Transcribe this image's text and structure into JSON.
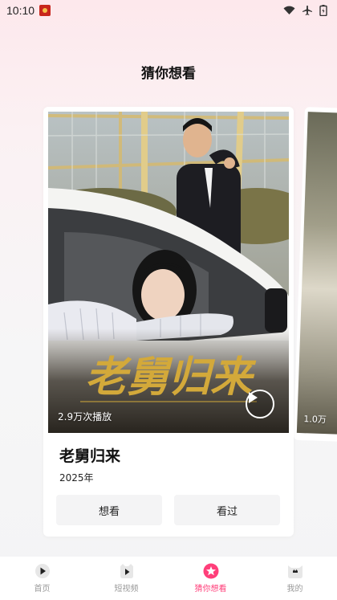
{
  "status_bar": {
    "time": "10:10",
    "icons": [
      "app-notification-icon",
      "wifi-icon",
      "airplane-mode-icon",
      "battery-icon"
    ]
  },
  "page": {
    "title": "猜你想看"
  },
  "current_card": {
    "title": "老舅归来",
    "year": "2025年",
    "play_count": "2.9万次播放",
    "want_button": "想看",
    "seen_button": "看过"
  },
  "next_card": {
    "play_count": "1.0万"
  },
  "bottom_nav": {
    "items": [
      {
        "label": "首页",
        "icon": "home-play-icon",
        "active": false
      },
      {
        "label": "短视频",
        "icon": "short-video-icon",
        "active": false
      },
      {
        "label": "猜你想看",
        "icon": "guess-flower-icon",
        "active": true
      },
      {
        "label": "我的",
        "icon": "cat-profile-icon",
        "active": false
      }
    ]
  },
  "colors": {
    "accent": "#ff3f7a",
    "card_bg": "#ffffff",
    "button_bg": "#f4f4f5"
  }
}
